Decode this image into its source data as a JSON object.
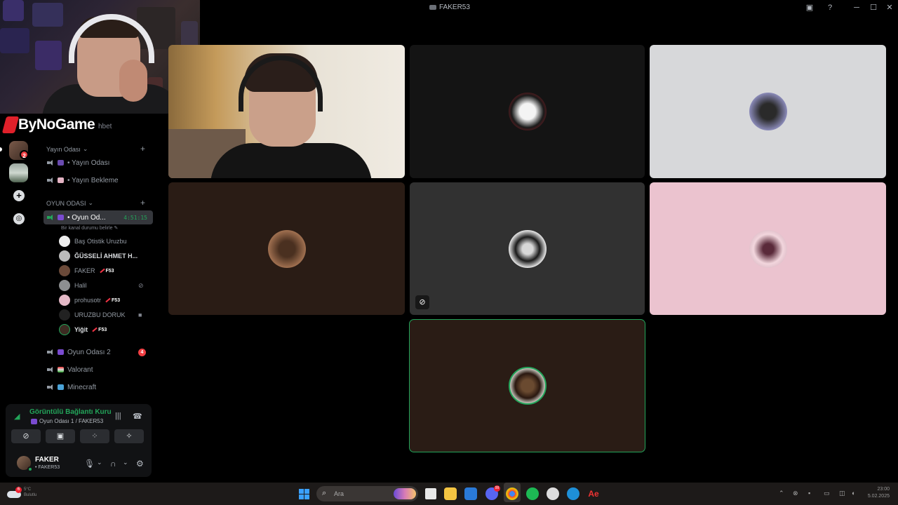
{
  "window": {
    "title": "FAKER53",
    "controls": [
      "minimize",
      "maximize",
      "close"
    ]
  },
  "brand": {
    "name": "ByNoGame",
    "trailing": "hbet"
  },
  "servers": {
    "badge_count": "2",
    "add_icon": "plus-icon",
    "discover_icon": "compass-icon"
  },
  "channels": {
    "category1": "Yayın Odası",
    "category1_items": [
      {
        "label": "• Yayın Odası"
      },
      {
        "label": "• Yayın Bekleme"
      }
    ],
    "category2": "OYUN ODASI",
    "active_channel": "• Oyun Od...",
    "active_timer": "4:51:15",
    "status_hint": "Bir kanal durumu belirle",
    "members": [
      {
        "name": "Baş Otistik Uruzbu",
        "tag": ""
      },
      {
        "name": "ĞÜSSELİ AHMET H...",
        "tag": "",
        "bold": true
      },
      {
        "name": "FAKER",
        "tag": "F53"
      },
      {
        "name": "Halil",
        "tag": ""
      },
      {
        "name": "prohusotr",
        "tag": "F53"
      },
      {
        "name": "URUZBU DORUK",
        "tag": ""
      },
      {
        "name": "Yiğit",
        "tag": "F53",
        "bold": true
      }
    ],
    "other_channels": [
      {
        "label": "Oyun Odası 2",
        "badge": "4"
      },
      {
        "label": "Valorant",
        "badge": ""
      },
      {
        "label": "Minecraft",
        "badge": ""
      }
    ]
  },
  "voice_panel": {
    "status": "Görüntülü Bağlantı Kuru",
    "location": "Oyun Odası 1 / FAKER53"
  },
  "user": {
    "name": "FAKER",
    "sub": "• FAKER53"
  },
  "taskbar": {
    "search_placeholder": "Ara",
    "weather_badge": "6",
    "weather_line1": "5°C",
    "weather_line2": "Bulutlu",
    "time": "23:00",
    "date": "5.02.2025",
    "discord_badge": "99"
  },
  "colors": {
    "accent_green": "#23a55a",
    "tile_pink": "#ebc3cf",
    "tile_brown": "#2a1c15",
    "tile_gray": "#d7d8da",
    "tile_dark": "#141414",
    "tile_charcoal": "#313131"
  }
}
